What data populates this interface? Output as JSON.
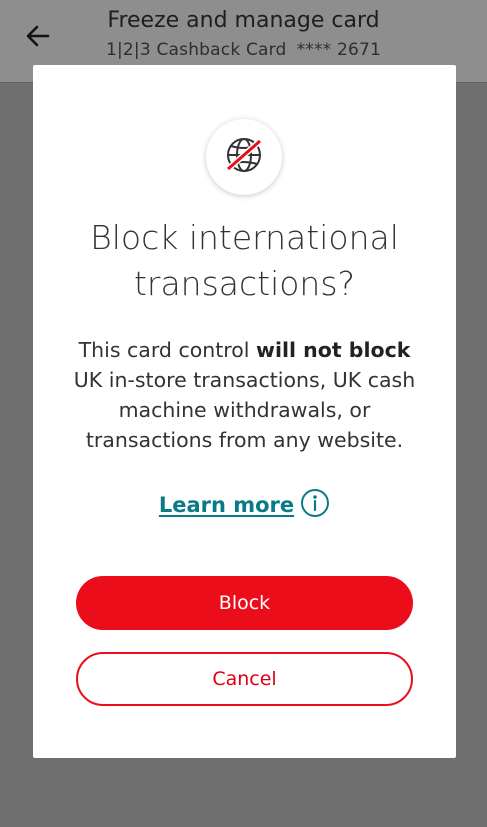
{
  "header": {
    "title": "Freeze and manage card",
    "card_name": "1|2|3 Cashback Card",
    "card_number": "**** 2671"
  },
  "dialog": {
    "icon": "globe-blocked-icon",
    "title": "Block international transactions?",
    "body_prefix": "This card control ",
    "body_bold": "will not block",
    "body_suffix": " UK in-store transactions, UK cash machine withdrawals, or transactions from any website.",
    "learn_more": "Learn more",
    "block_label": "Block",
    "cancel_label": "Cancel"
  },
  "colors": {
    "accent_red": "#ec0d1a",
    "link_teal": "#0a7b86",
    "overlay": "#6f6f6f"
  }
}
